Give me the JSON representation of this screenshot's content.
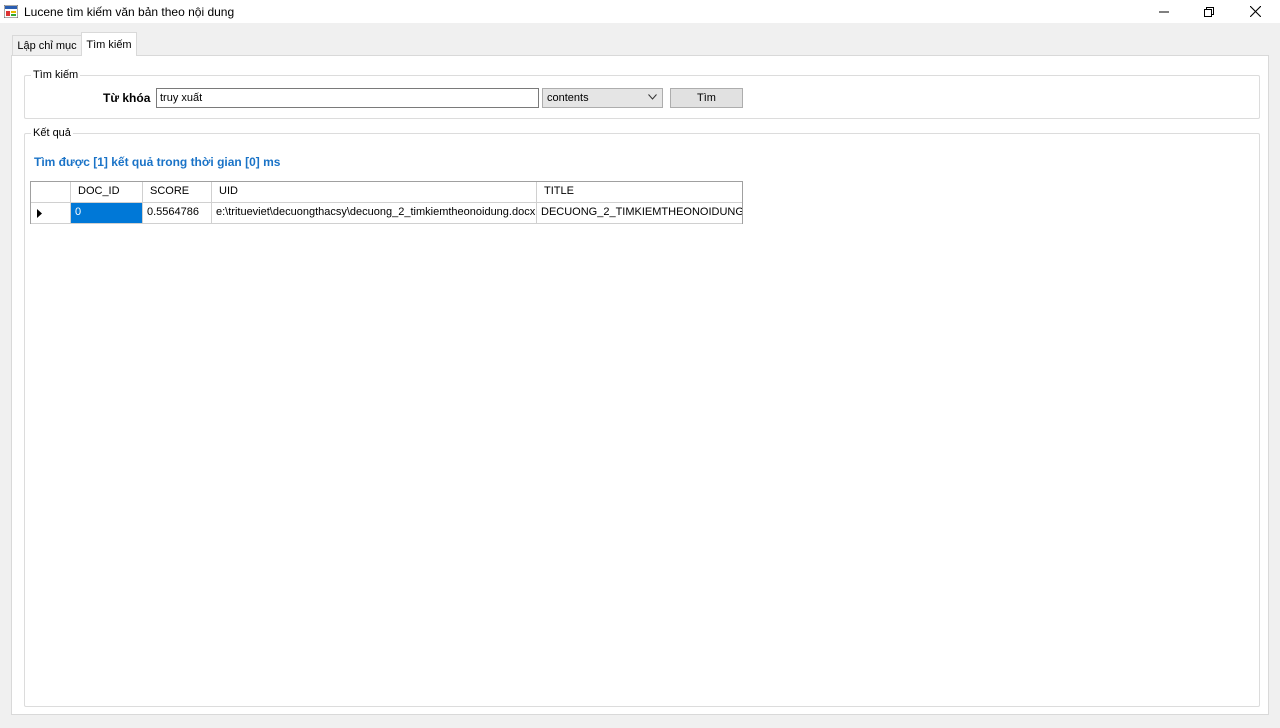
{
  "window": {
    "title": "Lucene tìm kiếm văn bản theo nội dung"
  },
  "tabs": [
    {
      "label": "Lập chỉ mục",
      "active": false
    },
    {
      "label": "Tìm kiếm",
      "active": true
    }
  ],
  "search_group": {
    "title": "Tìm kiếm",
    "keyword_label": "Từ khóa",
    "keyword_value": "truy xuất",
    "field_selected": "contents",
    "button_label": "Tìm"
  },
  "result_group": {
    "title": "Kết quả",
    "status": "Tìm được [1] kết quả trong thời gian [0] ms",
    "columns": [
      "DOC_ID",
      "SCORE",
      "UID",
      "TITLE"
    ],
    "rows": [
      {
        "doc_id": "0",
        "score": "0.5564786",
        "uid": "e:\\tritueviet\\decuongthacsy\\decuong_2_timkiemtheonoidung.docx",
        "title": "DECUONG_2_TIMKIEMTHEONOIDUNG"
      }
    ]
  },
  "colors": {
    "accent": "#1a73c7",
    "selection": "#0078d7"
  }
}
